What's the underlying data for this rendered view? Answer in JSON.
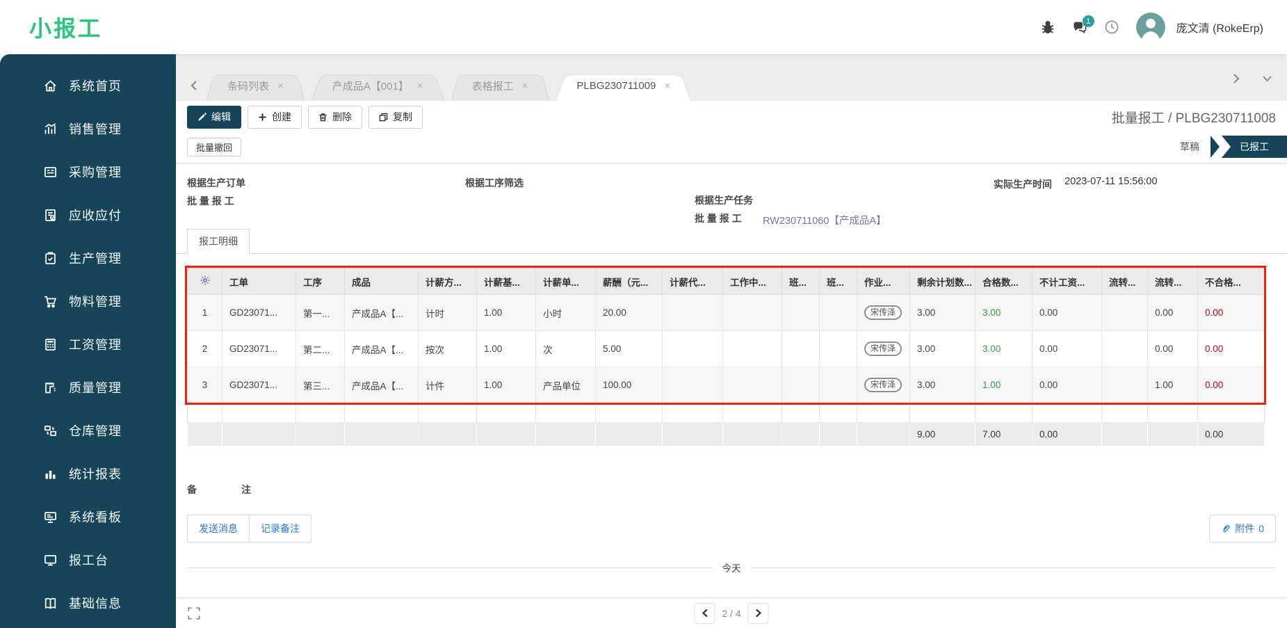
{
  "app": {
    "logo": "小报工",
    "user_name": "庞文清 (RokeErp)",
    "chat_badge": "1"
  },
  "sidebar": {
    "items": [
      {
        "label": "系统首页",
        "icon": "home-icon"
      },
      {
        "label": "销售管理",
        "icon": "sales-chart-icon"
      },
      {
        "label": "采购管理",
        "icon": "purchase-icon"
      },
      {
        "label": "应收应付",
        "icon": "receivable-payable-icon"
      },
      {
        "label": "生产管理",
        "icon": "production-icon"
      },
      {
        "label": "物料管理",
        "icon": "material-cart-icon"
      },
      {
        "label": "工资管理",
        "icon": "wage-icon"
      },
      {
        "label": "质量管理",
        "icon": "quality-icon"
      },
      {
        "label": "仓库管理",
        "icon": "warehouse-icon"
      },
      {
        "label": "统计报表",
        "icon": "report-chart-icon"
      },
      {
        "label": "系统看板",
        "icon": "dashboard-icon"
      },
      {
        "label": "报工台",
        "icon": "terminal-icon"
      },
      {
        "label": "基础信息",
        "icon": "base-info-icon"
      }
    ]
  },
  "tabbar": {
    "close_glyph": "×",
    "tabs": [
      {
        "label": "条码列表",
        "active": false
      },
      {
        "label": "产成品A【001】",
        "active": false
      },
      {
        "label": "表格报工",
        "active": false
      },
      {
        "label": "PLBG230711009",
        "active": true
      }
    ]
  },
  "toolbar": {
    "edit": "编辑",
    "create": "创建",
    "delete": "删除",
    "copy": "复制",
    "breadcrumb": "批量报工 / PLBG230711008"
  },
  "statusbar": {
    "recall": "批量撤回",
    "stages": [
      {
        "label": "草稿",
        "active": false
      },
      {
        "label": "已报工",
        "active": true
      }
    ]
  },
  "fields": {
    "order_batch": {
      "label_line1": "根据生产订单",
      "label_line2": "批 量 报 工",
      "value": ""
    },
    "process_filter": {
      "label": "根据工序筛选",
      "value": ""
    },
    "task_batch": {
      "label_line1": "根据生产任务",
      "label_line2": "批 量 报 工",
      "value": "RW230711060【产成品A】"
    },
    "actual_time": {
      "label": "实际生产时间",
      "value": "2023-07-11 15:56:00"
    }
  },
  "notebook": {
    "tab": "报工明细"
  },
  "detail_table": {
    "columns": [
      "工单",
      "工序",
      "成品",
      "计薪方...",
      "计薪基...",
      "计薪单...",
      "薪酬（元...",
      "计薪代...",
      "工作中...",
      "班...",
      "班...",
      "作业...",
      "剩余计划数...",
      "合格数...",
      "不计工资...",
      "流转...",
      "流转...",
      "不合格..."
    ],
    "rows": [
      {
        "num": "1",
        "work_order": "GD23071...",
        "process": "第一...",
        "product": "产成品A【...",
        "pay_method": "计时",
        "pay_base": "1.00",
        "pay_unit": "小时",
        "salary": "20.00",
        "pay_agent": "",
        "working": "",
        "shift1": "",
        "shift2": "",
        "operator": "宋传泽",
        "remaining": "3.00",
        "qualified": "3.00",
        "no_wage": "0.00",
        "flow1": "",
        "flow2": "0.00",
        "unqualified": "0.00"
      },
      {
        "num": "2",
        "work_order": "GD23071...",
        "process": "第二...",
        "product": "产成品A【...",
        "pay_method": "按次",
        "pay_base": "1.00",
        "pay_unit": "次",
        "salary": "5.00",
        "pay_agent": "",
        "working": "",
        "shift1": "",
        "shift2": "",
        "operator": "宋传泽",
        "remaining": "3.00",
        "qualified": "3.00",
        "no_wage": "0.00",
        "flow1": "",
        "flow2": "0.00",
        "unqualified": "0.00"
      },
      {
        "num": "3",
        "work_order": "GD23071...",
        "process": "第三...",
        "product": "产成品A【...",
        "pay_method": "计件",
        "pay_base": "1.00",
        "pay_unit": "产品单位",
        "salary": "100.00",
        "pay_agent": "",
        "working": "",
        "shift1": "",
        "shift2": "",
        "operator": "宋传泽",
        "remaining": "3.00",
        "qualified": "1.00",
        "no_wage": "0.00",
        "flow1": "",
        "flow2": "1.00",
        "unqualified": "0.00"
      }
    ],
    "summary": {
      "remaining": "9.00",
      "qualified": "7.00",
      "no_wage": "0.00",
      "unqualified": "0.00"
    }
  },
  "chatter": {
    "note_label_left": "备",
    "note_label_right": "注",
    "send_message": "发送消息",
    "log_note": "记录备注",
    "attachment_label": "附件",
    "attachment_count": "0",
    "today": "今天"
  },
  "pager": {
    "page_text": "2 / 4"
  },
  "colors": {
    "brand_green": "#2BC57D",
    "sidebar_bg": "#16455A",
    "accent_dark": "#16455A",
    "main_bg": "#ECECEC",
    "link_purple": "#7A6FC0",
    "value_green": "#2F9E44",
    "value_red": "#D0021B",
    "annotation_red": "#EE2211",
    "action_blue": "#2878F0",
    "avatar_teal": "#6CA09C",
    "badge_teal": "#2AA198"
  }
}
